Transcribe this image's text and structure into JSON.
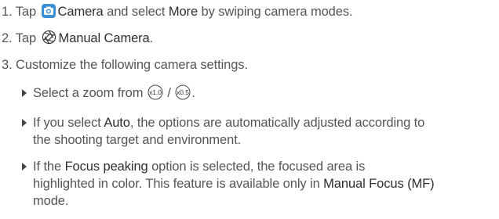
{
  "steps": [
    {
      "num": "1.",
      "pre": "Tap",
      "app": "Camera",
      "mid": "and select",
      "more": "More",
      "post": "by swiping camera modes."
    },
    {
      "num": "2.",
      "pre": "Tap",
      "target": "Manual Camera",
      "post": "."
    },
    {
      "num": "3.",
      "text": "Customize the following camera settings."
    }
  ],
  "bullets": {
    "zoom": {
      "pre": "Select a zoom from",
      "sep": "/",
      "post": ".",
      "zoom1": "x1.0",
      "zoom2": "x0.5"
    },
    "auto": {
      "pre": "If you select",
      "term": "Auto",
      "post": ", the options are automatically adjusted according to",
      "line2": "the shooting target and environment."
    },
    "focus": {
      "pre": "If the",
      "term": "Focus peaking",
      "post": "option is selected, the focused area is",
      "line2_pre": "highlighted in color. This feature is available only in",
      "line2_term": "Manual Focus (MF)",
      "line3": "mode."
    }
  },
  "colors": {
    "text": "#555555",
    "emphasis": "#2e2e2e",
    "camera_icon": "#3c8fd6"
  },
  "icons": [
    "camera-app-icon",
    "aperture-icon",
    "zoom-x1-icon",
    "zoom-x0.5-icon",
    "bullet-triangle-icon"
  ]
}
